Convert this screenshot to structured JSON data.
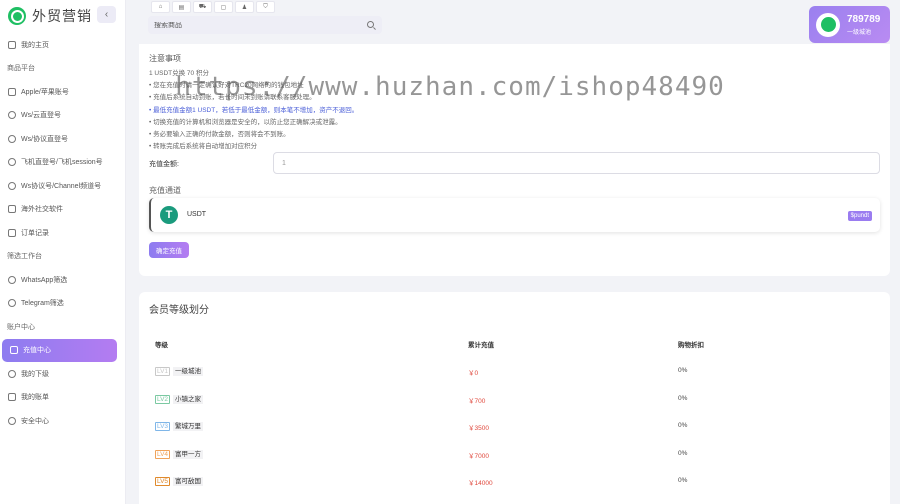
{
  "brand": {
    "name": "外贸营销",
    "collapse": "‹"
  },
  "sidebar": {
    "items": [
      {
        "type": "item",
        "label": "我的主页",
        "icon": "home-icon"
      },
      {
        "type": "section",
        "label": "商品平台"
      },
      {
        "type": "item",
        "label": "Apple/苹果账号",
        "icon": "mail-icon"
      },
      {
        "type": "item",
        "label": "Ws/云直登号",
        "icon": "whatsapp-icon"
      },
      {
        "type": "item",
        "label": "Ws/协议直登号",
        "icon": "whatsapp-icon"
      },
      {
        "type": "item",
        "label": "飞机直登号/飞机session号",
        "icon": "telegram-icon"
      },
      {
        "type": "item",
        "label": "Ws协议号/Channel频道号",
        "icon": "whatsapp-icon"
      },
      {
        "type": "item",
        "label": "海外社交软件",
        "icon": "grid-icon"
      },
      {
        "type": "item",
        "label": "订单记录",
        "icon": "order-icon"
      },
      {
        "type": "section",
        "label": "筛选工作台"
      },
      {
        "type": "item",
        "label": "WhatsApp筛选",
        "icon": "whatsapp-icon"
      },
      {
        "type": "item",
        "label": "Telegram筛选",
        "icon": "telegram-icon"
      },
      {
        "type": "section",
        "label": "账户中心"
      },
      {
        "type": "item",
        "label": "充值中心",
        "icon": "wallet-icon",
        "active": true
      },
      {
        "type": "item",
        "label": "我的下级",
        "icon": "user-icon"
      },
      {
        "type": "item",
        "label": "我的账单",
        "icon": "bill-icon"
      },
      {
        "type": "item",
        "label": "安全中心",
        "icon": "shield-icon"
      }
    ]
  },
  "topbar": {
    "search_placeholder": "搜索商品",
    "tools": [
      "⌂",
      "▤",
      "⛟",
      "▢",
      "♟",
      "⛉"
    ]
  },
  "user": {
    "id": "789789",
    "level": "一级城池"
  },
  "recharge": {
    "notice_title": "注意事项",
    "notice_lines": [
      {
        "text": "1 USDT兑换 70 积分",
        "blue": false
      },
      {
        "text": "• 您在充值时请一定确认好对TRC20网络的的钱包地址",
        "blue": false
      },
      {
        "text": "• 充值后系统自动到账，若长时间未到账请联系客服处理。",
        "blue": false
      },
      {
        "text": "• 最低充值金额1 USDT，若低于最低金额，则本笔不增加，资产不退回。",
        "blue": true
      },
      {
        "text": "• 切换充值的计算机和浏览器是安全的，以防止您正确解决或泄露。",
        "blue": false
      },
      {
        "text": "• 务必要输入正确的付款金额，否则将会不到账。",
        "blue": false
      },
      {
        "text": "• 转账完成后系统将自动增加对应积分",
        "blue": false
      }
    ],
    "amount_label": "充值金额:",
    "amount_value": "1",
    "channel_title": "充值通道",
    "channel_icon": "T",
    "channel_label": "USDT",
    "channel_badge": "$pundt",
    "confirm_label": "确定充值"
  },
  "levels": {
    "title": "会员等级划分",
    "headers": [
      "等级",
      "累计充值",
      "购物折扣"
    ],
    "rows": [
      {
        "tag": "LV1",
        "name": "一级城池",
        "amount": "￥0",
        "discount": "0%",
        "color": "#c8c8c8"
      },
      {
        "tag": "LV2",
        "name": "小镇之家",
        "amount": "￥700",
        "discount": "0%",
        "color": "#7bc9a2"
      },
      {
        "tag": "LV3",
        "name": "繁城万里",
        "amount": "￥3500",
        "discount": "0%",
        "color": "#7fb6e8"
      },
      {
        "tag": "LV4",
        "name": "富甲一方",
        "amount": "￥7000",
        "discount": "0%",
        "color": "#f0a35a"
      },
      {
        "tag": "LV5",
        "name": "富可敌国",
        "amount": "￥14000",
        "discount": "0%",
        "color": "#e08a2c"
      }
    ]
  },
  "watermark": "https://www.huzhan.com/ishop48490"
}
